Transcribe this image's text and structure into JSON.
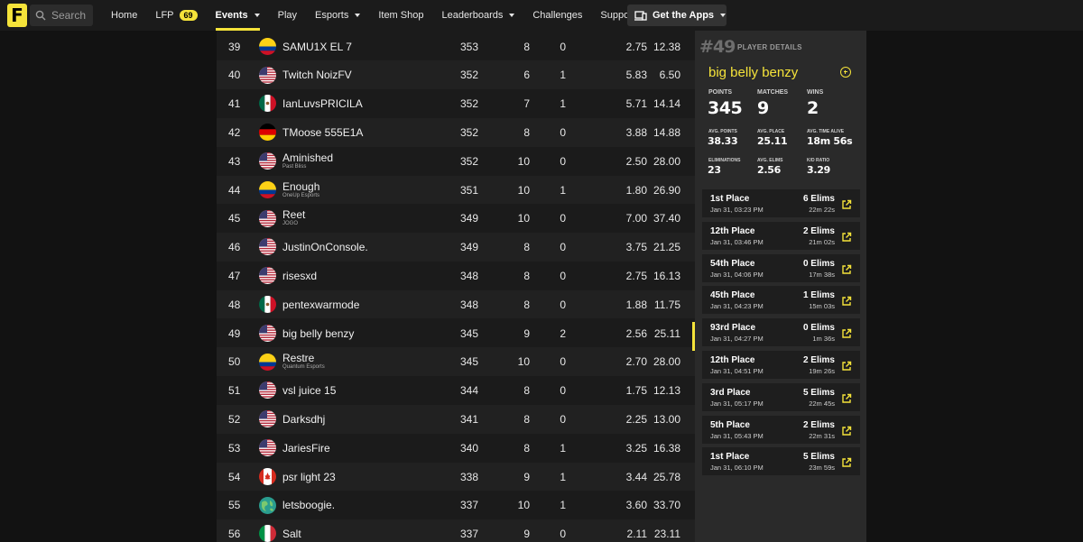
{
  "nav": {
    "logo": "F",
    "search_placeholder": "Search",
    "items": [
      {
        "label": "Home"
      },
      {
        "label": "LFP",
        "badge": "69"
      },
      {
        "label": "Events",
        "dropdown": true,
        "active": true
      },
      {
        "label": "Play"
      },
      {
        "label": "Esports",
        "dropdown": true
      },
      {
        "label": "Item Shop"
      },
      {
        "label": "Leaderboards",
        "dropdown": true
      },
      {
        "label": "Challenges"
      },
      {
        "label": "Support"
      }
    ],
    "apps_label": "Get the Apps"
  },
  "leaderboard": {
    "rows": [
      {
        "rank": "39",
        "flag": "CO",
        "name": "SAMU1X EL 7",
        "team": "",
        "points": "353",
        "matches": "8",
        "wins": "0",
        "avg_place": "2.75",
        "avg_elims": "12.38"
      },
      {
        "rank": "40",
        "flag": "US",
        "name": "Twitch NoizFV",
        "team": "",
        "points": "352",
        "matches": "6",
        "wins": "1",
        "avg_place": "5.83",
        "avg_elims": "6.50"
      },
      {
        "rank": "41",
        "flag": "MX",
        "name": "IanLuvsPRICILA",
        "team": "",
        "points": "352",
        "matches": "7",
        "wins": "1",
        "avg_place": "5.71",
        "avg_elims": "14.14"
      },
      {
        "rank": "42",
        "flag": "DE",
        "name": "TMoose 555E1A",
        "team": "",
        "points": "352",
        "matches": "8",
        "wins": "0",
        "avg_place": "3.88",
        "avg_elims": "14.88"
      },
      {
        "rank": "43",
        "flag": "US",
        "name": "Aminished",
        "team": "Past Bliss",
        "points": "352",
        "matches": "10",
        "wins": "0",
        "avg_place": "2.50",
        "avg_elims": "28.00"
      },
      {
        "rank": "44",
        "flag": "CO",
        "name": "Enough",
        "team": "OneUp Esports",
        "points": "351",
        "matches": "10",
        "wins": "1",
        "avg_place": "1.80",
        "avg_elims": "26.90"
      },
      {
        "rank": "45",
        "flag": "US",
        "name": "Reet",
        "team": "JOGO",
        "points": "349",
        "matches": "10",
        "wins": "0",
        "avg_place": "7.00",
        "avg_elims": "37.40"
      },
      {
        "rank": "46",
        "flag": "US",
        "name": "JustinOnConsole.",
        "team": "",
        "points": "349",
        "matches": "8",
        "wins": "0",
        "avg_place": "3.75",
        "avg_elims": "21.25"
      },
      {
        "rank": "47",
        "flag": "US",
        "name": "risesxd",
        "team": "",
        "points": "348",
        "matches": "8",
        "wins": "0",
        "avg_place": "2.75",
        "avg_elims": "16.13"
      },
      {
        "rank": "48",
        "flag": "MX",
        "name": "pentexwarmode",
        "team": "",
        "points": "348",
        "matches": "8",
        "wins": "0",
        "avg_place": "1.88",
        "avg_elims": "11.75"
      },
      {
        "rank": "49",
        "flag": "US",
        "name": "big belly benzy",
        "team": "",
        "points": "345",
        "matches": "9",
        "wins": "2",
        "avg_place": "2.56",
        "avg_elims": "25.11"
      },
      {
        "rank": "50",
        "flag": "CO",
        "name": "Restre",
        "team": "Quantum Esports",
        "points": "345",
        "matches": "10",
        "wins": "0",
        "avg_place": "2.70",
        "avg_elims": "28.00"
      },
      {
        "rank": "51",
        "flag": "US",
        "name": "vsl juice 15",
        "team": "",
        "points": "344",
        "matches": "8",
        "wins": "0",
        "avg_place": "1.75",
        "avg_elims": "12.13"
      },
      {
        "rank": "52",
        "flag": "US",
        "name": "Darksdhj",
        "team": "",
        "points": "341",
        "matches": "8",
        "wins": "0",
        "avg_place": "2.25",
        "avg_elims": "13.00"
      },
      {
        "rank": "53",
        "flag": "US",
        "name": "JariesFire",
        "team": "",
        "points": "340",
        "matches": "8",
        "wins": "1",
        "avg_place": "3.25",
        "avg_elims": "16.38"
      },
      {
        "rank": "54",
        "flag": "CA",
        "name": "psr light 23",
        "team": "",
        "points": "338",
        "matches": "9",
        "wins": "1",
        "avg_place": "3.44",
        "avg_elims": "25.78"
      },
      {
        "rank": "55",
        "flag": "GLOBE",
        "name": "letsboogie.",
        "team": "",
        "points": "337",
        "matches": "10",
        "wins": "1",
        "avg_place": "3.60",
        "avg_elims": "33.70"
      },
      {
        "rank": "56",
        "flag": "IT",
        "name": "Salt",
        "team": "",
        "points": "337",
        "matches": "9",
        "wins": "0",
        "avg_place": "2.11",
        "avg_elims": "23.11"
      }
    ]
  },
  "player": {
    "number": "#49",
    "section_label": "PLAYER DETAILS",
    "name": "big belly benzy",
    "points_label": "POINTS",
    "points": "345",
    "matches_label": "MATCHES",
    "matches": "9",
    "wins_label": "WINS",
    "wins": "2",
    "avg_points_label": "AVG. POINTS",
    "avg_points": "38.33",
    "avg_place_label": "AVG. PLACE",
    "avg_place": "25.11",
    "avg_time_label": "AVG. TIME ALIVE",
    "avg_time": "18m 56s",
    "elims_label": "ELIMINATIONS",
    "elims": "23",
    "avg_elims_label": "AVG. ELIMS",
    "avg_elims": "2.56",
    "kd_label": "K/D RATIO",
    "kd": "3.29",
    "matches_list": [
      {
        "place": "1st Place",
        "date": "Jan 31, 03:23 PM",
        "elims": "6 Elims",
        "time": "22m 22s"
      },
      {
        "place": "12th Place",
        "date": "Jan 31, 03:46 PM",
        "elims": "2 Elims",
        "time": "21m 02s"
      },
      {
        "place": "54th Place",
        "date": "Jan 31, 04:06 PM",
        "elims": "0 Elims",
        "time": "17m 38s"
      },
      {
        "place": "45th Place",
        "date": "Jan 31, 04:23 PM",
        "elims": "1 Elims",
        "time": "15m 03s"
      },
      {
        "place": "93rd Place",
        "date": "Jan 31, 04:27 PM",
        "elims": "0 Elims",
        "time": "1m 36s"
      },
      {
        "place": "12th Place",
        "date": "Jan 31, 04:51 PM",
        "elims": "2 Elims",
        "time": "19m 26s"
      },
      {
        "place": "3rd Place",
        "date": "Jan 31, 05:17 PM",
        "elims": "5 Elims",
        "time": "22m 45s"
      },
      {
        "place": "5th Place",
        "date": "Jan 31, 05:43 PM",
        "elims": "2 Elims",
        "time": "22m 31s"
      },
      {
        "place": "1st Place",
        "date": "Jan 31, 06:10 PM",
        "elims": "5 Elims",
        "time": "23m 59s"
      }
    ]
  },
  "colors": {
    "accent": "#f5e33a",
    "nav_bg": "#1b1b1b",
    "panel_bg": "#2a2a2a",
    "table_bg": "#1b1b1b",
    "row_alt": "#212121"
  }
}
